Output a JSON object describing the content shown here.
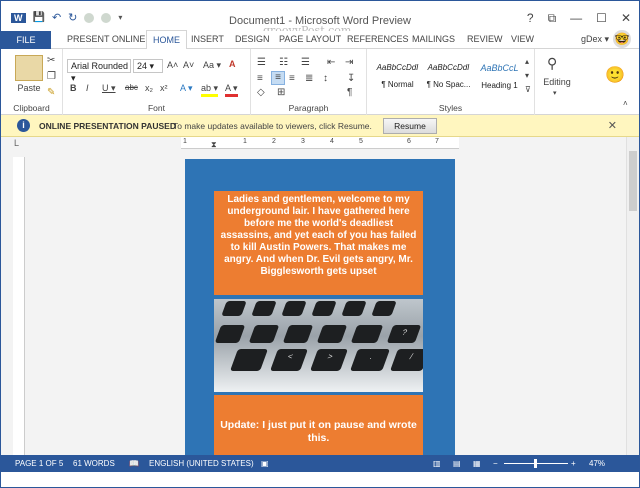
{
  "window": {
    "title": "Document1 - Microsoft Word Preview",
    "watermark": "groovyPost.com",
    "help": "?",
    "ribbon_options": "⧉",
    "minimize": "—",
    "maximize": "☐",
    "close": "✕"
  },
  "qat": {
    "word_icon": "W",
    "save_icon": "💾",
    "undo_icon": "↶",
    "redo_icon": "↻"
  },
  "tabs": [
    "FILE",
    "PRESENT ONLINE",
    "HOME",
    "INSERT",
    "DESIGN",
    "PAGE LAYOUT",
    "REFERENCES",
    "MAILINGS",
    "REVIEW",
    "VIEW"
  ],
  "user": {
    "name": "gDex ▾",
    "avatar": "🤓",
    "smiley": "🙂"
  },
  "ribbon": {
    "clipboard": {
      "label": "Clipboard",
      "paste": "Paste"
    },
    "font": {
      "label": "Font",
      "family": "Arial Rounded ▾",
      "size": "24 ▾",
      "grow": "A˄",
      "shrink": "A˅",
      "case": "Aa ▾",
      "clear": "A",
      "bold": "B",
      "italic": "I",
      "underline": "U ▾",
      "strike": "abc",
      "sub": "x₂",
      "sup": "x²",
      "effects": "A ▾",
      "highlight": "ab ▾",
      "color": "A ▾"
    },
    "paragraph": {
      "label": "Paragraph"
    },
    "styles": {
      "label": "Styles",
      "items": [
        {
          "preview": "AaBbCcDdI",
          "name": "¶ Normal"
        },
        {
          "preview": "AaBbCcDdI",
          "name": "¶ No Spac..."
        },
        {
          "preview": "AaBbCcL",
          "name": "Heading 1"
        }
      ]
    },
    "editing": {
      "label": "Editing"
    }
  },
  "infobar": {
    "title": "ONLINE PRESENTATION PAUSED",
    "message": "To make updates available to viewers, click Resume.",
    "button": "Resume",
    "close": "✕",
    "icon": "i"
  },
  "document": {
    "box1_text": "Ladies and gentlemen, welcome to my underground lair. I have gathered here before me the world's deadliest assassins, and yet each of you has failed to kill Austin Powers. That makes me angry. And when Dr. Evil gets angry, Mr. Bigglesworth gets upset",
    "box2_text": "Update: I just put it on pause and wrote this.",
    "keys": [
      "?",
      "/",
      ">",
      ".",
      "<",
      ","
    ],
    "ruler_marks": [
      "1",
      "1",
      "2",
      "3",
      "4",
      "5",
      "6",
      "7"
    ],
    "ruler_corner": "L"
  },
  "status": {
    "page": "PAGE 1 OF 5",
    "words": "61 WORDS",
    "language": "ENGLISH (UNITED STATES)",
    "zoom_minus": "−",
    "zoom_plus": "+",
    "zoom": "47%",
    "zoom_fraction": 0.47
  },
  "colors": {
    "accent": "#2b579a",
    "orange": "#ed7d31",
    "page_blue": "#2e74b5",
    "infobar": "#fff6bf"
  }
}
